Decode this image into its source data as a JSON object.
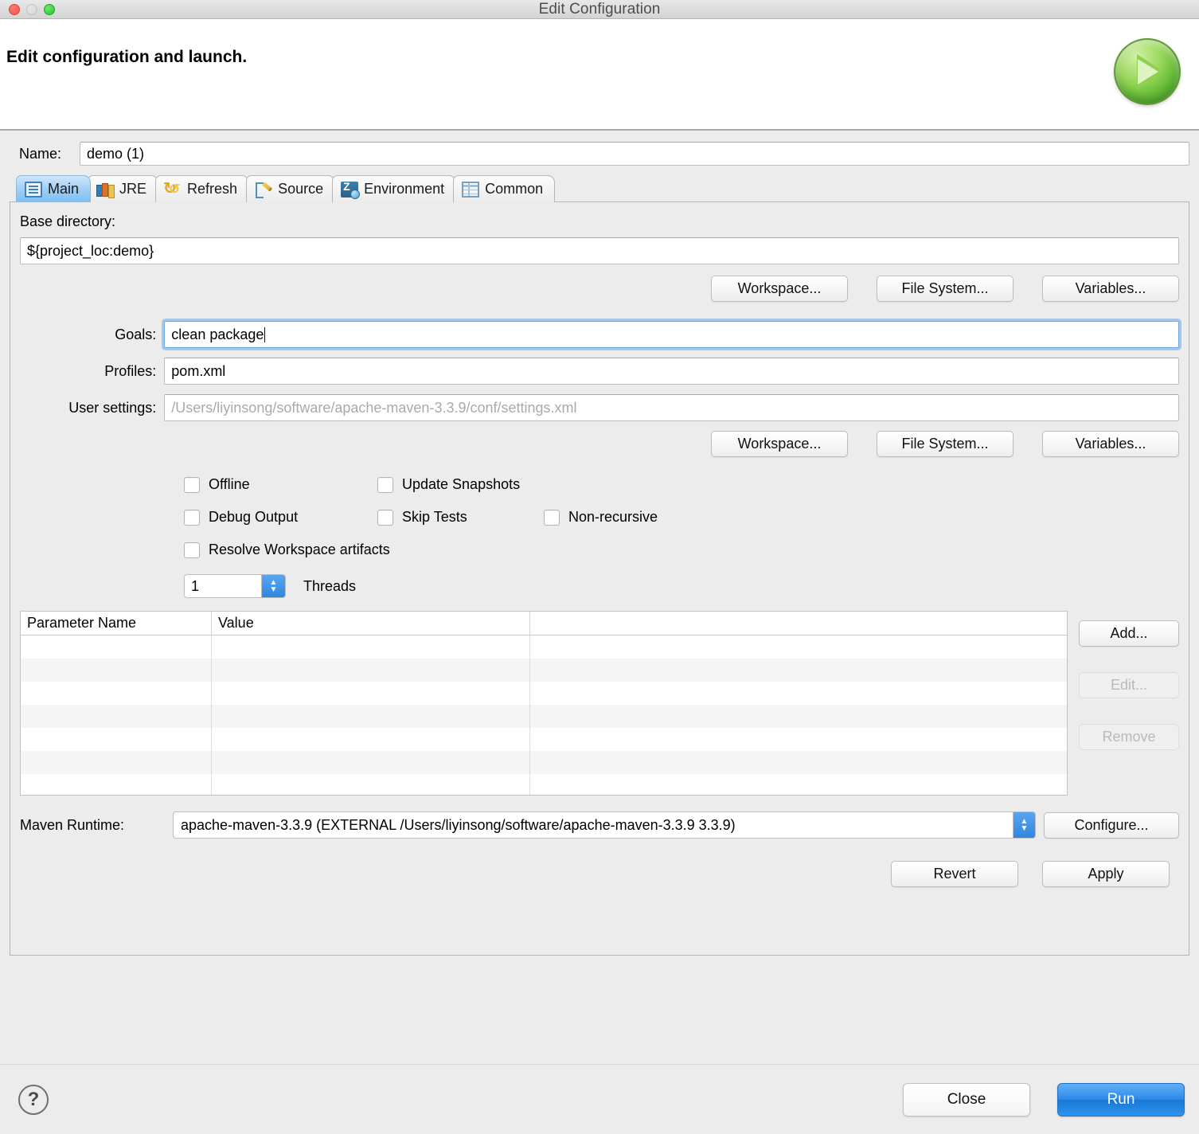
{
  "window": {
    "title": "Edit Configuration",
    "traffic_lights": [
      "close-button",
      "minimize-button",
      "zoom-button"
    ]
  },
  "header": {
    "title": "Edit configuration and launch.",
    "run_icon": "run-play-icon"
  },
  "name": {
    "label": "Name:",
    "value": "demo (1)"
  },
  "tabs": [
    {
      "label": "Main",
      "icon": "main-clipboard-icon",
      "selected": true
    },
    {
      "label": "JRE",
      "icon": "jre-books-icon",
      "selected": false
    },
    {
      "label": "Refresh",
      "icon": "refresh-arrows-icon",
      "selected": false
    },
    {
      "label": "Source",
      "icon": "source-tree-pencil-icon",
      "selected": false
    },
    {
      "label": "Environment",
      "icon": "environment-icon",
      "selected": false
    },
    {
      "label": "Common",
      "icon": "common-table-icon",
      "selected": false
    }
  ],
  "main": {
    "base_directory": {
      "label": "Base directory:",
      "value": "${project_loc:demo}"
    },
    "base_buttons": [
      {
        "label": "Workspace..."
      },
      {
        "label": "File System..."
      },
      {
        "label": "Variables..."
      }
    ],
    "goals": {
      "label": "Goals:",
      "value": "clean package",
      "focused": true
    },
    "profiles": {
      "label": "Profiles:",
      "value": "pom.xml"
    },
    "user_settings": {
      "label": "User settings:",
      "value": "",
      "placeholder": "/Users/liyinsong/software/apache-maven-3.3.9/conf/settings.xml"
    },
    "settings_buttons": [
      {
        "label": "Workspace..."
      },
      {
        "label": "File System..."
      },
      {
        "label": "Variables..."
      }
    ],
    "checkboxes": [
      {
        "label": "Offline",
        "checked": false
      },
      {
        "label": "Update Snapshots",
        "checked": false
      },
      {
        "label": "Debug Output",
        "checked": false
      },
      {
        "label": "Skip Tests",
        "checked": false
      },
      {
        "label": "Non-recursive",
        "checked": false
      },
      {
        "label": "Resolve Workspace artifacts",
        "checked": false
      }
    ],
    "threads": {
      "value": "1",
      "label": "Threads"
    },
    "parameters_table": {
      "columns": [
        "Parameter Name",
        "Value",
        ""
      ],
      "rows": [],
      "empty_row_count": 7
    },
    "table_buttons": [
      {
        "label": "Add...",
        "enabled": true
      },
      {
        "label": "Edit...",
        "enabled": false
      },
      {
        "label": "Remove",
        "enabled": false
      }
    ],
    "maven_runtime": {
      "label": "Maven Runtime:",
      "value": "apache-maven-3.3.9 (EXTERNAL /Users/liyinsong/software/apache-maven-3.3.9 3.3.9)",
      "configure_label": "Configure..."
    },
    "panel_actions": [
      {
        "label": "Revert"
      },
      {
        "label": "Apply"
      }
    ]
  },
  "footer": {
    "help_icon": "help-question-icon",
    "close_label": "Close",
    "run_label": "Run"
  },
  "colors": {
    "window_bg": "#ececec",
    "accent_blue": "#2f86e0",
    "tab_selected": "#9ccdf5",
    "focus_ring": "#6aa9e0",
    "run_button": "#2e8ae8",
    "disabled_text": "#b9b9b9",
    "placeholder_text": "#aaaaaa"
  }
}
